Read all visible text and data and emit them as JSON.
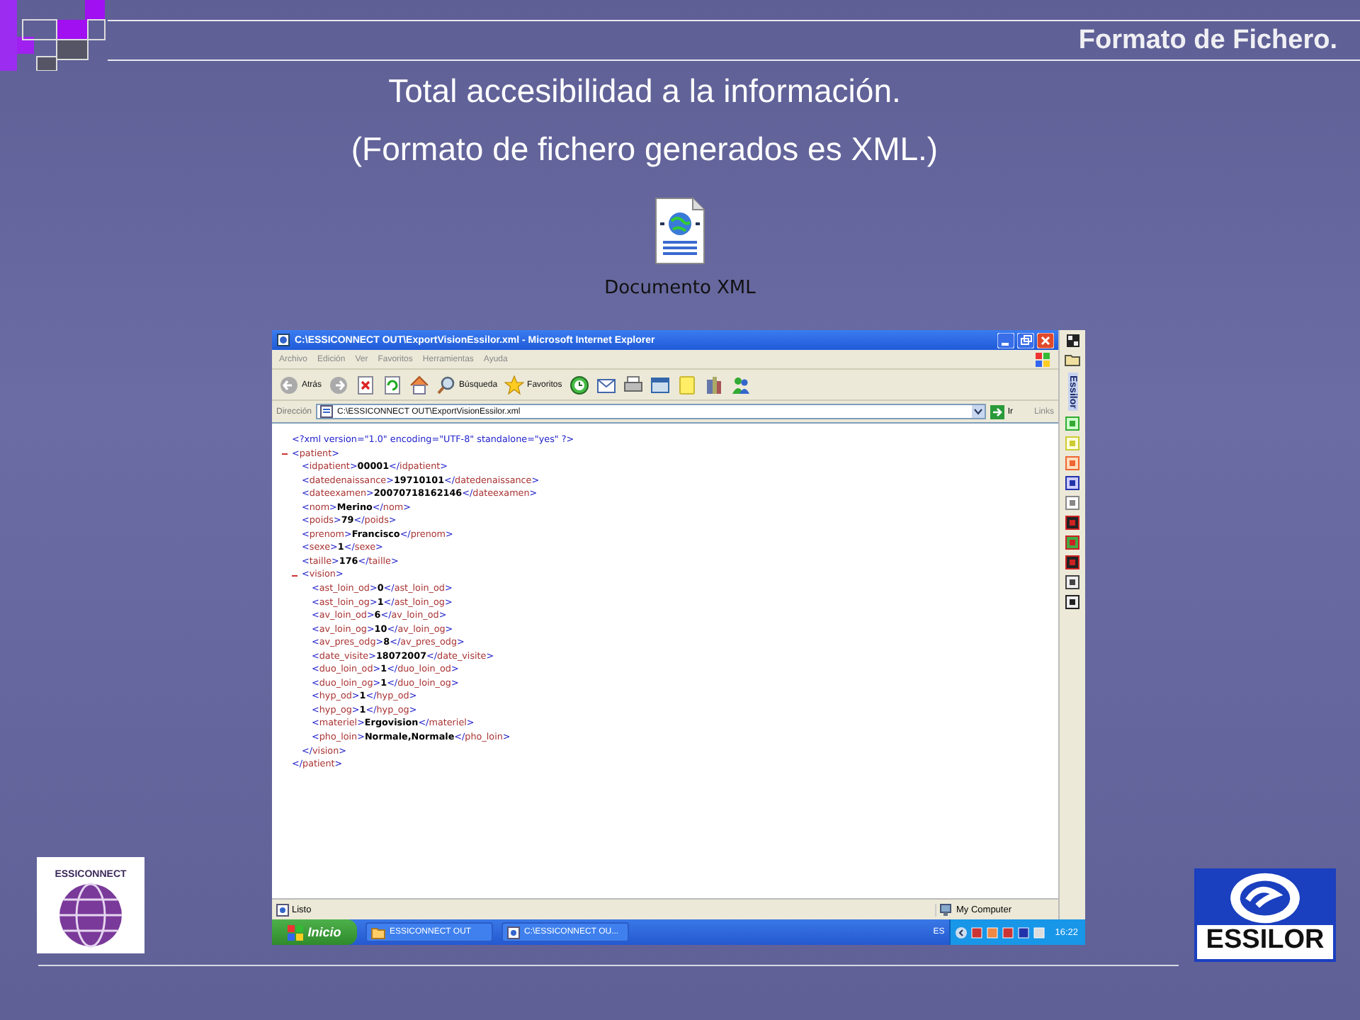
{
  "slide": {
    "title": "Formato de Fichero.",
    "headline": "Total accesibilidad a la información.",
    "subheadline": "(Formato de fichero generados es XML.)"
  },
  "file_icon": {
    "label": "Documento XML"
  },
  "browser": {
    "title": "C:\\ESSICONNECT OUT\\ExportVisionEssilor.xml - Microsoft Internet Explorer",
    "menu": [
      "Archivo",
      "Edición",
      "Ver",
      "Favoritos",
      "Herramientas",
      "Ayuda"
    ],
    "toolbar": [
      {
        "kind": "back",
        "label": "Atrás"
      },
      {
        "kind": "forward"
      },
      {
        "kind": "stop"
      },
      {
        "kind": "refresh"
      },
      {
        "kind": "home"
      },
      {
        "kind": "search",
        "label": "Búsqueda"
      },
      {
        "kind": "favorites",
        "label": "Favoritos"
      },
      {
        "kind": "history"
      },
      {
        "kind": "mail"
      },
      {
        "kind": "print"
      },
      {
        "kind": "edit"
      },
      {
        "kind": "note"
      },
      {
        "kind": "research"
      },
      {
        "kind": "messenger"
      }
    ],
    "address_label": "Dirección",
    "address": "C:\\ESSICONNECT OUT\\ExportVisionEssilor.xml",
    "go": "Ir",
    "links": "Links",
    "side_panel_title": "Essilor",
    "xml": {
      "declaration": "<?xml version=\"1.0\" encoding=\"UTF-8\" standalone=\"yes\" ?>",
      "root": {
        "open": "<patient>",
        "close": "</patient>",
        "expanded": true,
        "children": [
          {
            "open": "<idpatient>",
            "value": "00001",
            "close": "</idpatient>"
          },
          {
            "open": "<datedenaissance>",
            "value": "19710101",
            "close": "</datedenaissance>"
          },
          {
            "open": "<dateexamen>",
            "value": "20070718162146",
            "close": "</dateexamen>"
          },
          {
            "open": "<nom>",
            "value": "Merino",
            "close": "</nom>"
          },
          {
            "open": "<poids>",
            "value": "79",
            "close": "</poids>"
          },
          {
            "open": "<prenom>",
            "value": "Francisco",
            "close": "</prenom>"
          },
          {
            "open": "<sexe>",
            "value": "1",
            "close": "</sexe>"
          },
          {
            "open": "<taille>",
            "value": "176",
            "close": "</taille>"
          },
          {
            "open": "<vision>",
            "close": "</vision>",
            "expanded": true,
            "children": [
              {
                "open": "<ast_loin_od>",
                "value": "0",
                "close": "</ast_loin_od>"
              },
              {
                "open": "<ast_loin_og>",
                "value": "1",
                "close": "</ast_loin_og>"
              },
              {
                "open": "<av_loin_od>",
                "value": "6",
                "close": "</av_loin_od>"
              },
              {
                "open": "<av_loin_og>",
                "value": "10",
                "close": "</av_loin_og>"
              },
              {
                "open": "<av_pres_odg>",
                "value": "8",
                "close": "</av_pres_odg>"
              },
              {
                "open": "<date_visite>",
                "value": "18072007",
                "close": "</date_visite>"
              },
              {
                "open": "<duo_loin_od>",
                "value": "1",
                "close": "</duo_loin_od>"
              },
              {
                "open": "<duo_loin_og>",
                "value": "1",
                "close": "</duo_loin_og>"
              },
              {
                "open": "<hyp_od>",
                "value": "1",
                "close": "</hyp_od>"
              },
              {
                "open": "<hyp_og>",
                "value": "1",
                "close": "</hyp_og>"
              },
              {
                "open": "<materiel>",
                "value": "Ergovision",
                "close": "</materiel>"
              },
              {
                "open": "<pho_loin>",
                "value": "Normale,Normale",
                "close": "</pho_loin>"
              }
            ]
          }
        ]
      }
    },
    "status": "Listo",
    "zone": "My Computer"
  },
  "taskbar": {
    "start": "Inicio",
    "tasks": [
      {
        "label": "ESSICONNECT OUT",
        "selected": false
      },
      {
        "label": "C:\\ESSICONNECT OU...",
        "selected": false
      }
    ],
    "language": "ES",
    "clock": "16:22"
  },
  "logos": {
    "left": "ESSICONNECT",
    "right": "ESSILOR"
  }
}
